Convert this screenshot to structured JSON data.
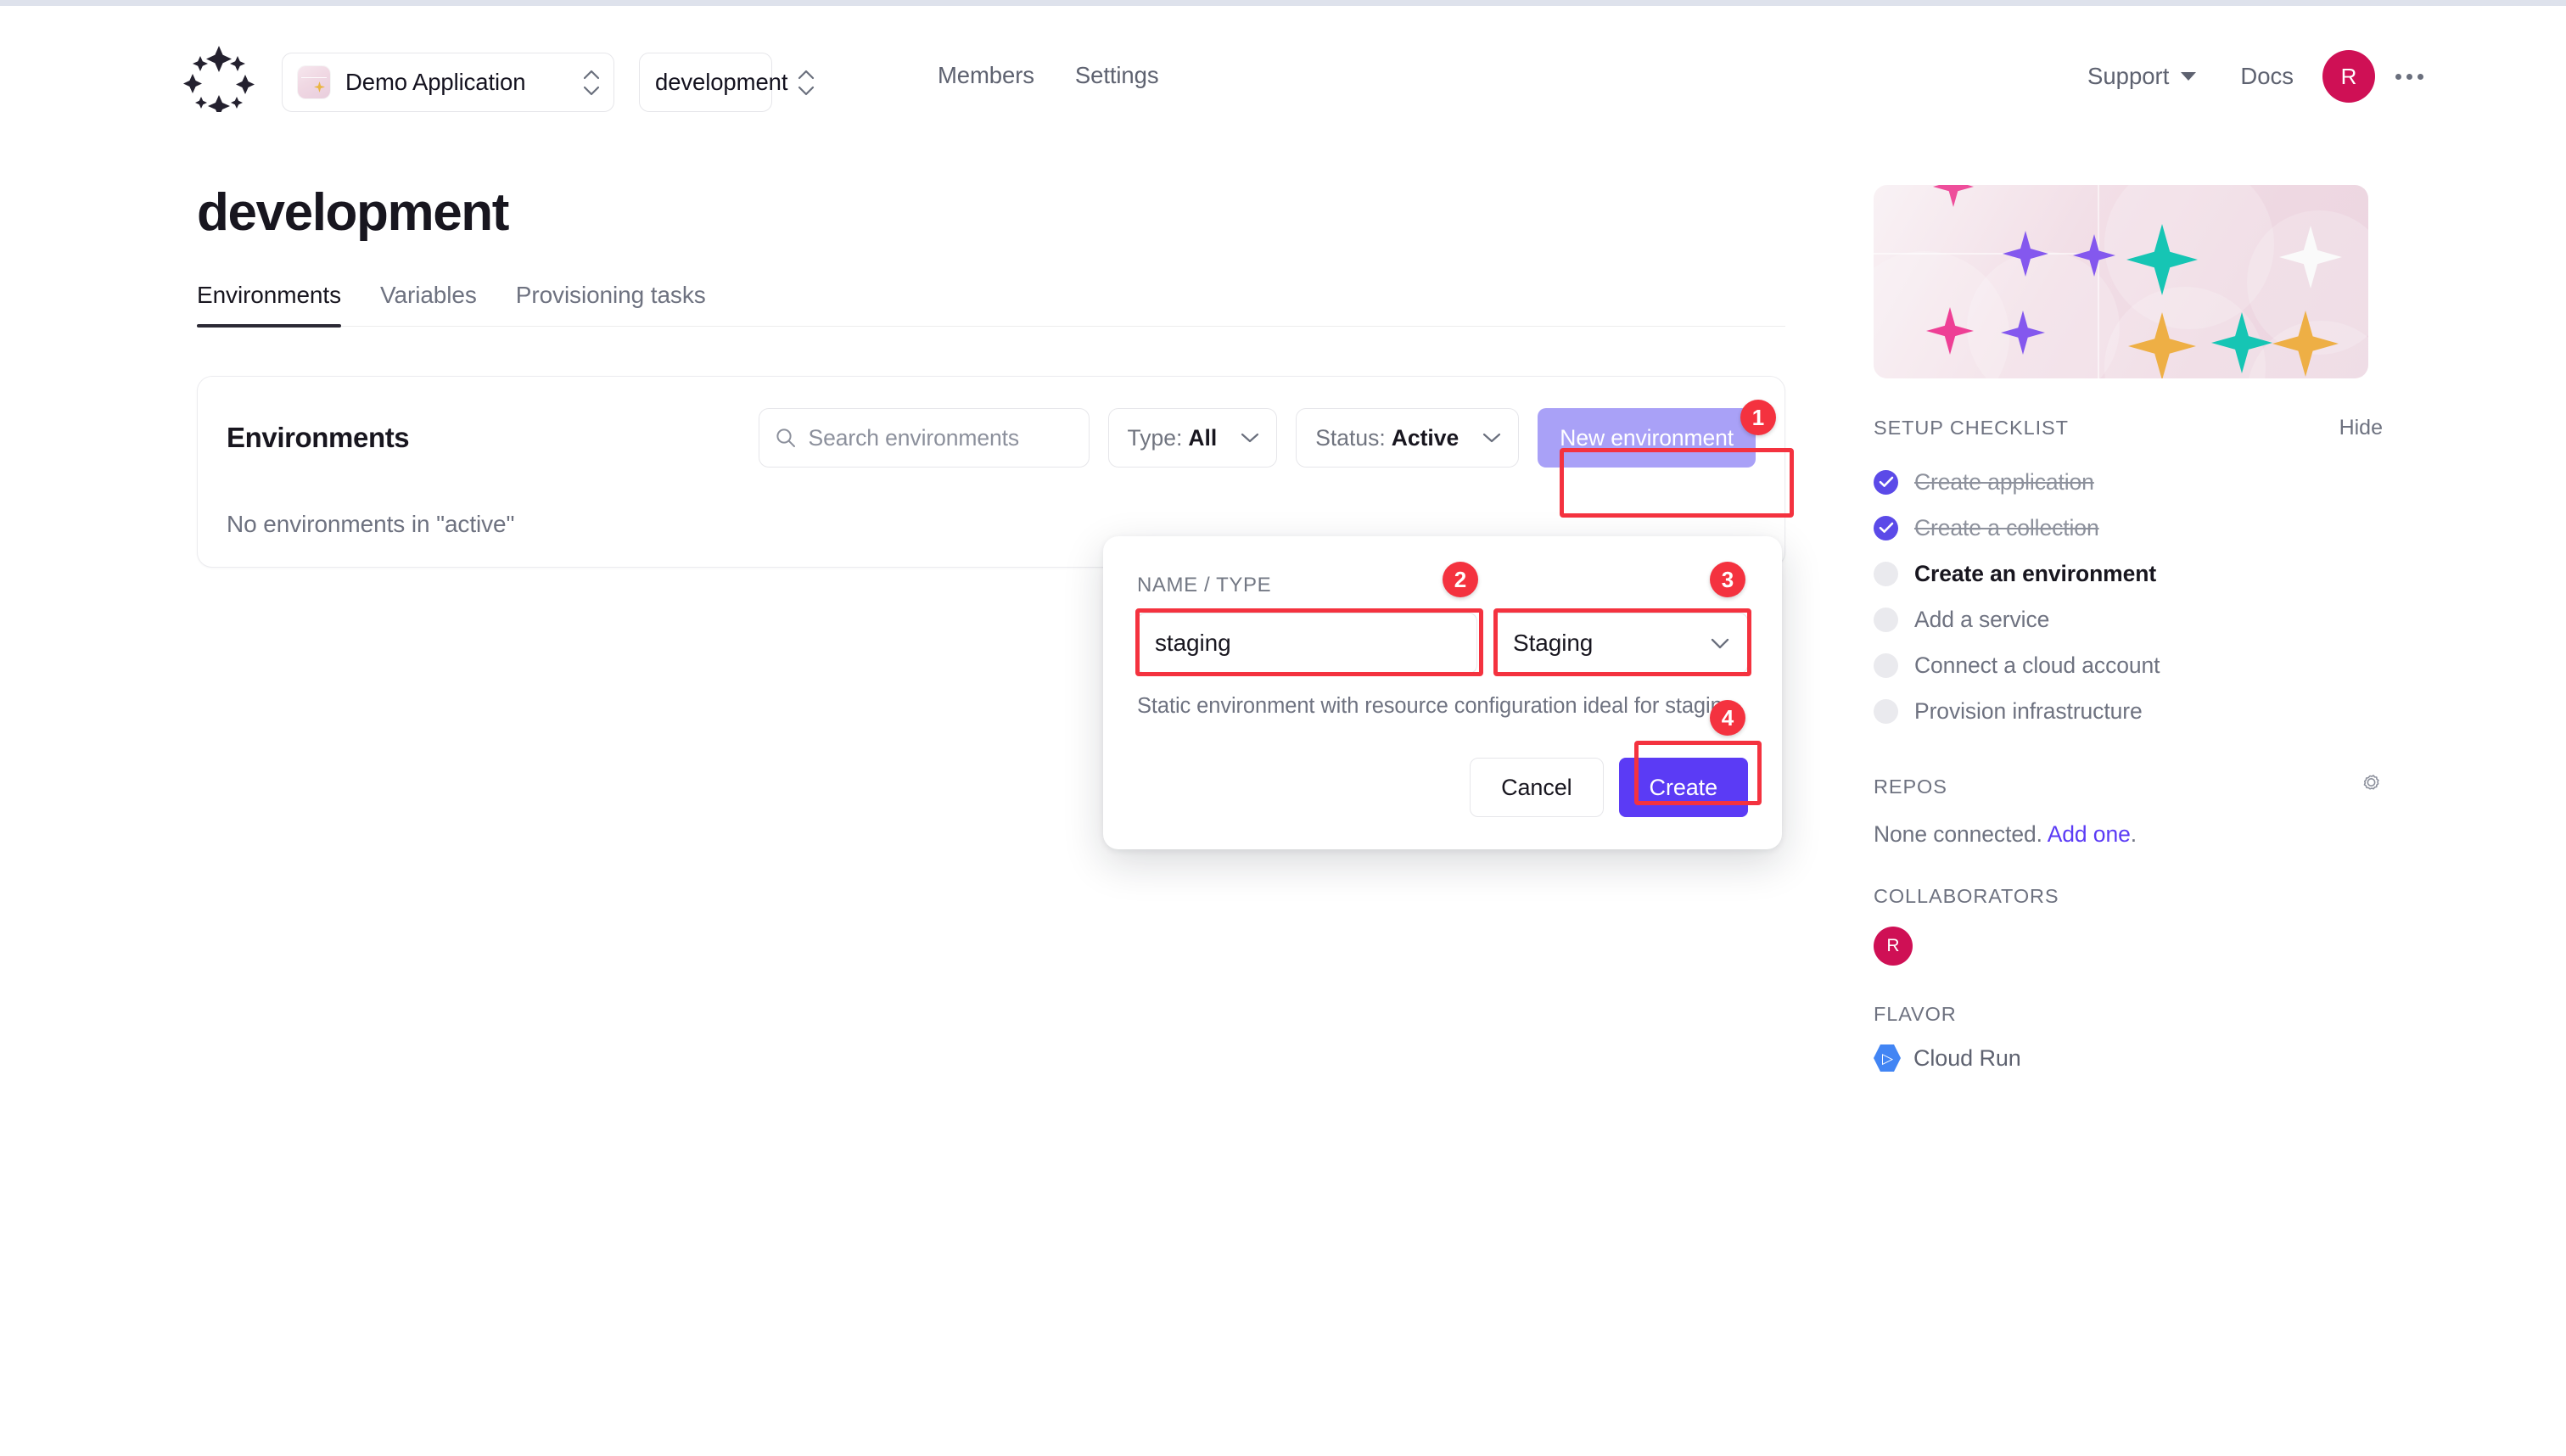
{
  "header": {
    "logo_icon": "sparkle-ring-logo",
    "app_switcher": {
      "label": "Demo Application",
      "icon": "app-thumbnail-icon"
    },
    "env_switcher": {
      "label": "development"
    },
    "nav": [
      {
        "label": "Members"
      },
      {
        "label": "Settings"
      }
    ],
    "support": {
      "label": "Support"
    },
    "docs": {
      "label": "Docs"
    },
    "avatar": {
      "initial": "R",
      "color": "#cf1055"
    },
    "overflow_icon": "ellipsis-horizontal-icon"
  },
  "main": {
    "page_title": "development",
    "title_overflow_icon": "ellipsis-horizontal-icon",
    "tabs": [
      {
        "label": "Environments",
        "active": true
      },
      {
        "label": "Variables",
        "active": false
      },
      {
        "label": "Provisioning tasks",
        "active": false
      }
    ],
    "card": {
      "title": "Environments",
      "search": {
        "placeholder": "Search environments",
        "value": "",
        "icon": "search-icon"
      },
      "type_filter": {
        "label": "Type:",
        "value": "All",
        "icon": "chevron-down-icon"
      },
      "status_filter": {
        "label": "Status:",
        "value": "Active",
        "icon": "chevron-down-icon"
      },
      "new_environment_button": {
        "label": "New environment",
        "color": "#a9a1f7"
      },
      "empty_message": "No environments in \"active\""
    }
  },
  "dialog": {
    "section_label": "NAME / TYPE",
    "name_input": {
      "value": "staging",
      "placeholder": ""
    },
    "type_select": {
      "value": "Staging",
      "icon": "chevron-down-icon"
    },
    "help_text": "Static environment with resource configuration ideal for staging.",
    "cancel_button": "Cancel",
    "create_button": {
      "label": "Create",
      "color": "#5b3bf5"
    }
  },
  "sidebar": {
    "banner": {
      "icon": "sparkles-banner-illustration"
    },
    "checklist": {
      "title": "SETUP CHECKLIST",
      "hide_label": "Hide",
      "items": [
        {
          "label": "Create application",
          "state": "done"
        },
        {
          "label": "Create a collection",
          "state": "done"
        },
        {
          "label": "Create an environment",
          "state": "current"
        },
        {
          "label": "Add a service",
          "state": "todo"
        },
        {
          "label": "Connect a cloud account",
          "state": "todo"
        },
        {
          "label": "Provision infrastructure",
          "state": "todo"
        }
      ]
    },
    "repos": {
      "title": "REPOS",
      "settings_icon": "gear-icon",
      "empty_text": "None connected.",
      "link_text": "Add one",
      "trailing": "."
    },
    "collaborators": {
      "title": "COLLABORATORS",
      "avatars": [
        {
          "initial": "R",
          "color": "#cf1055"
        }
      ]
    },
    "flavor": {
      "title": "FLAVOR",
      "name": "Cloud Run",
      "icon": "cloud-run-icon"
    }
  },
  "annotations": [
    {
      "number": "1",
      "target": "new-environment-button"
    },
    {
      "number": "2",
      "target": "environment-name-input"
    },
    {
      "number": "3",
      "target": "environment-type-select"
    },
    {
      "number": "4",
      "target": "create-button"
    }
  ]
}
